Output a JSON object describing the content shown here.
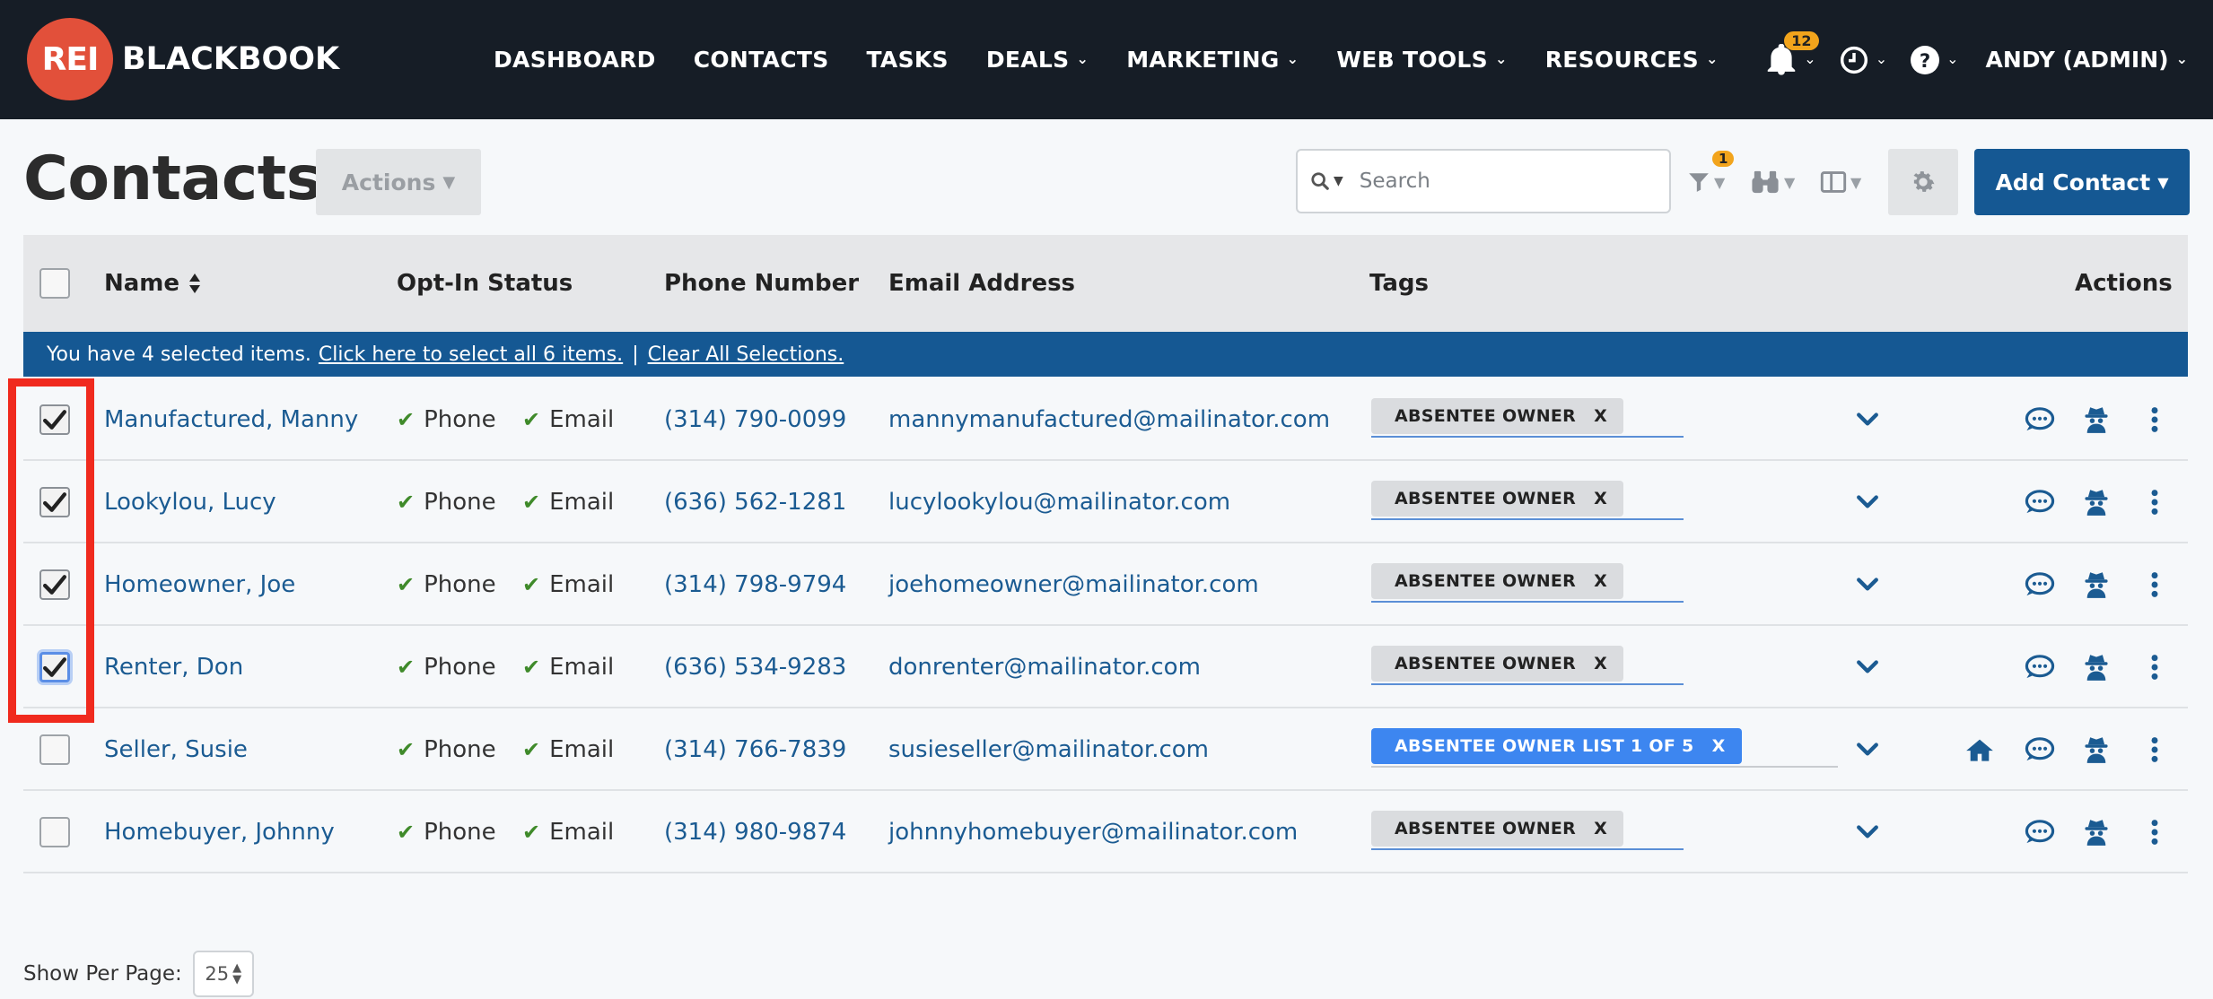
{
  "brand": {
    "logo_mark": "REI",
    "logo_text": "BLACKBOOK",
    "accent": "#e2503a",
    "nav_bg": "#161d26",
    "primary": "#155893"
  },
  "nav": {
    "items": [
      {
        "label": "DASHBOARD",
        "dropdown": false
      },
      {
        "label": "CONTACTS",
        "dropdown": false
      },
      {
        "label": "TASKS",
        "dropdown": false
      },
      {
        "label": "DEALS",
        "dropdown": true
      },
      {
        "label": "MARKETING",
        "dropdown": true
      },
      {
        "label": "WEB TOOLS",
        "dropdown": true
      },
      {
        "label": "RESOURCES",
        "dropdown": true
      }
    ],
    "notifications_count": "12",
    "user_label": "ANDY (ADMIN)",
    "icons": [
      "bell-icon",
      "clock-icon",
      "help-icon"
    ]
  },
  "header": {
    "title": "Contacts",
    "actions_label": "Actions",
    "search_placeholder": "Search",
    "filter_count": "1",
    "add_contact_label": "Add Contact"
  },
  "table": {
    "columns": {
      "name": "Name",
      "optin": "Opt-In Status",
      "phone": "Phone Number",
      "email": "Email Address",
      "tags": "Tags",
      "actions": "Actions"
    },
    "selection_bar": {
      "text": "You have 4 selected items.",
      "select_all": "Click here to select all 6 items.",
      "separator": "|",
      "clear": "Clear All Selections."
    },
    "rows": [
      {
        "checked": true,
        "name": "Manufactured, Manny",
        "optin_phone": "Phone",
        "optin_email": "Email",
        "phone": "(314) 790-0099",
        "email": "mannymanufactured@mailinator.com",
        "tag": "ABSENTEE OWNER",
        "tag_style": "grey",
        "home_icon": false
      },
      {
        "checked": true,
        "name": "Lookylou, Lucy",
        "optin_phone": "Phone",
        "optin_email": "Email",
        "phone": "(636) 562-1281",
        "email": "lucylookylou@mailinator.com",
        "tag": "ABSENTEE OWNER",
        "tag_style": "grey",
        "home_icon": false
      },
      {
        "checked": true,
        "name": "Homeowner, Joe",
        "optin_phone": "Phone",
        "optin_email": "Email",
        "phone": "(314) 798-9794",
        "email": "joehomeowner@mailinator.com",
        "tag": "ABSENTEE OWNER",
        "tag_style": "grey",
        "home_icon": false
      },
      {
        "checked": true,
        "name": "Renter, Don",
        "optin_phone": "Phone",
        "optin_email": "Email",
        "phone": "(636) 534-9283",
        "email": "donrenter@mailinator.com",
        "tag": "ABSENTEE OWNER",
        "tag_style": "grey",
        "home_icon": false
      },
      {
        "checked": false,
        "name": "Seller, Susie",
        "optin_phone": "Phone",
        "optin_email": "Email",
        "phone": "(314) 766-7839",
        "email": "susieseller@mailinator.com",
        "tag": "ABSENTEE OWNER LIST 1 OF 5",
        "tag_style": "blue",
        "home_icon": true
      },
      {
        "checked": false,
        "name": "Homebuyer, Johnny",
        "optin_phone": "Phone",
        "optin_email": "Email",
        "phone": "(314) 980-9874",
        "email": "johnnyhomebuyer@mailinator.com",
        "tag": "ABSENTEE OWNER",
        "tag_style": "grey",
        "home_icon": false
      }
    ],
    "tag_remove_glyph": "X",
    "row_icons": [
      "chevron-down-icon",
      "home-icon",
      "chat-icon",
      "spy-icon",
      "more-vertical-icon"
    ]
  },
  "footer": {
    "per_page_label": "Show Per Page:",
    "per_page_value": "25"
  }
}
